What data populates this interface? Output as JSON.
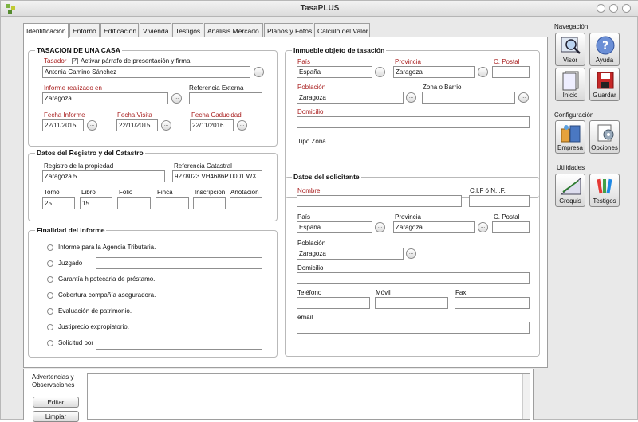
{
  "window": {
    "title": "TasaPLUS"
  },
  "tabs": [
    {
      "label": "Identificación"
    },
    {
      "label": "Entorno"
    },
    {
      "label": "Edificación"
    },
    {
      "label": "Vivienda"
    },
    {
      "label": "Testigos"
    },
    {
      "label": "Análisis Mercado"
    },
    {
      "label": "Planos y Fotos"
    },
    {
      "label": "Cálculo del Valor"
    }
  ],
  "tasacion": {
    "title": "TASACION DE UNA CASA",
    "tasador_label": "Tasador",
    "activar_label": "Activar párrafo de presentación y firma",
    "tasador_value": "Antonia Camino Sánchez",
    "informe_label": "Informe realizado en",
    "informe_value": "Zaragoza",
    "ref_externa_label": "Referencia Externa",
    "ref_externa_value": "",
    "fecha_informe_label": "Fecha Informe",
    "fecha_informe_value": "22/11/2015",
    "fecha_visita_label": "Fecha Visita",
    "fecha_visita_value": "22/11/2015",
    "fecha_caducidad_label": "Fecha Caducidad",
    "fecha_caducidad_value": "22/11/2016"
  },
  "registro": {
    "title": "Datos del Registro y del Catastro",
    "registro_label": "Registro de la propiedad",
    "registro_value": "Zaragoza 5",
    "ref_catastral_label": "Referencia Catastral",
    "ref_catastral_value": "9278023 VH4686P 0001 WX",
    "tomo_label": "Tomo",
    "tomo_value": "25",
    "libro_label": "Libro",
    "libro_value": "15",
    "folio_label": "Folio",
    "folio_value": "",
    "finca_label": "Finca",
    "finca_value": "",
    "inscripcion_label": "Inscripción",
    "inscripcion_value": "",
    "anotacion_label": "Anotación",
    "anotacion_value": ""
  },
  "finalidad": {
    "title": "Finalidad del informe",
    "options": [
      {
        "label": "Informe para la Agencia Tributaria."
      },
      {
        "label": "Juzgado"
      },
      {
        "label": "Garantía hipotecaria de préstamo."
      },
      {
        "label": "Cobertura compañía aseguradora."
      },
      {
        "label": "Evaluación de patrimonio."
      },
      {
        "label": "Justiprecio expropiatorio."
      },
      {
        "label": "Solicitud por"
      }
    ]
  },
  "inmueble": {
    "title": "Inmueble objeto de tasación",
    "pais_label": "País",
    "pais_value": "España",
    "provincia_label": "Provincia",
    "provincia_value": "Zaragoza",
    "cpostal_label": "C. Postal",
    "cpostal_value": "",
    "poblacion_label": "Población",
    "poblacion_value": "Zaragoza",
    "zona_label": "Zona o Barrio",
    "zona_value": "",
    "domicilio_label": "Domicilio",
    "domicilio_value": "",
    "tipo_zona_label": "Tipo Zona"
  },
  "solicitante": {
    "title": "Datos del solicitante",
    "nombre_label": "Nombre",
    "nombre_value": "",
    "cif_label": "C.I.F ó N.I.F.",
    "cif_value": "",
    "pais_label": "País",
    "pais_value": "España",
    "provincia_label": "Provincia",
    "provincia_value": "Zaragoza",
    "cpostal_label": "C. Postal",
    "cpostal_value": "",
    "poblacion_label": "Población",
    "poblacion_value": "Zaragoza",
    "domicilio_label": "Domicilio",
    "domicilio_value": "",
    "telefono_label": "Teléfono",
    "telefono_value": "",
    "movil_label": "Móvil",
    "movil_value": "",
    "fax_label": "Fax",
    "fax_value": "",
    "email_label": "email",
    "email_value": ""
  },
  "bottom": {
    "advertencias_label": "Advertencias y Observaciones",
    "editar_label": "Editar",
    "limpiar_label": "Limpiar"
  },
  "sidebar": {
    "navegacion_label": "Navegación",
    "visor_label": "Visor",
    "ayuda_label": "Ayuda",
    "inicio_label": "Inicio",
    "guardar_label": "Guardar",
    "configuracion_label": "Configuración",
    "empresa_label": "Empresa",
    "opciones_label": "Opciones",
    "utilidades_label": "Utilidades",
    "croquis_label": "Croquis",
    "testigos_label": "Testigos"
  },
  "ellipsis": "..."
}
